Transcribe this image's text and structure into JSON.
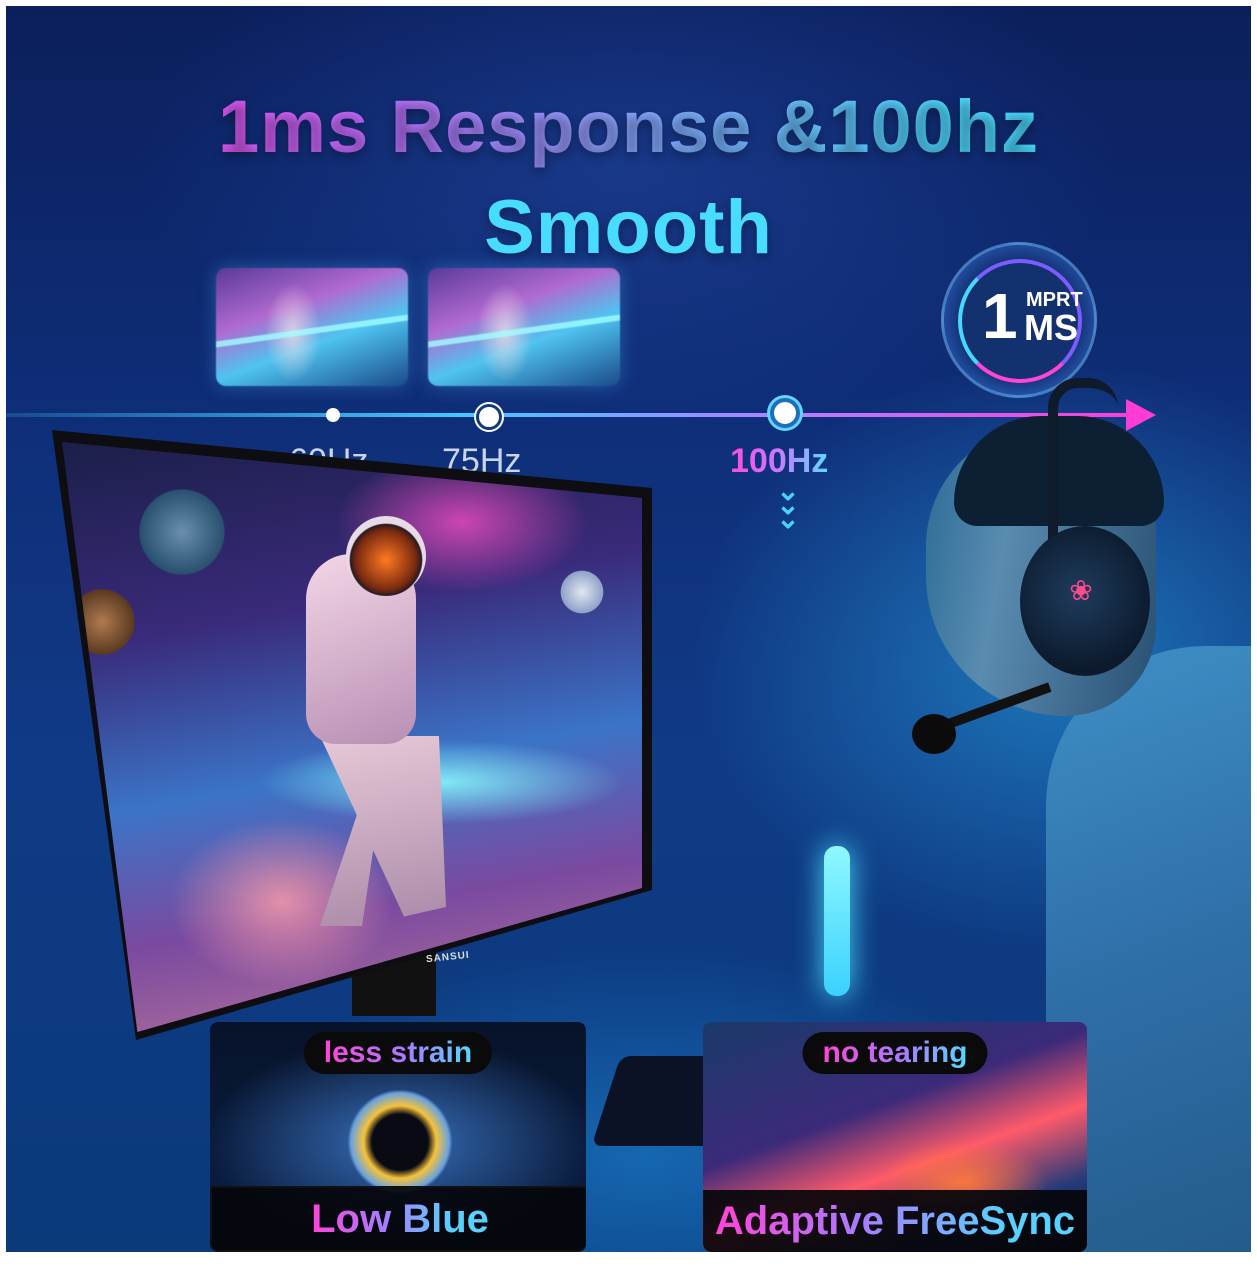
{
  "headline": {
    "line1": "1ms Response &100hz",
    "line2": "Smooth"
  },
  "badge": {
    "number": "1",
    "top": "MPRT",
    "bottom": "MS"
  },
  "timeline": {
    "labels": [
      "60Hz",
      "75Hz",
      "100Hz"
    ]
  },
  "monitor": {
    "brand": "SANSUI"
  },
  "cards": {
    "left": {
      "tag": "less strain",
      "label": "Low Blue"
    },
    "right": {
      "tag": "no tearing",
      "label": "Adaptive FreeSync"
    }
  },
  "colors": {
    "pink": "#ff3bd6",
    "purple": "#a97bff",
    "cyan": "#48dcff",
    "background": "#0f2f7a"
  }
}
